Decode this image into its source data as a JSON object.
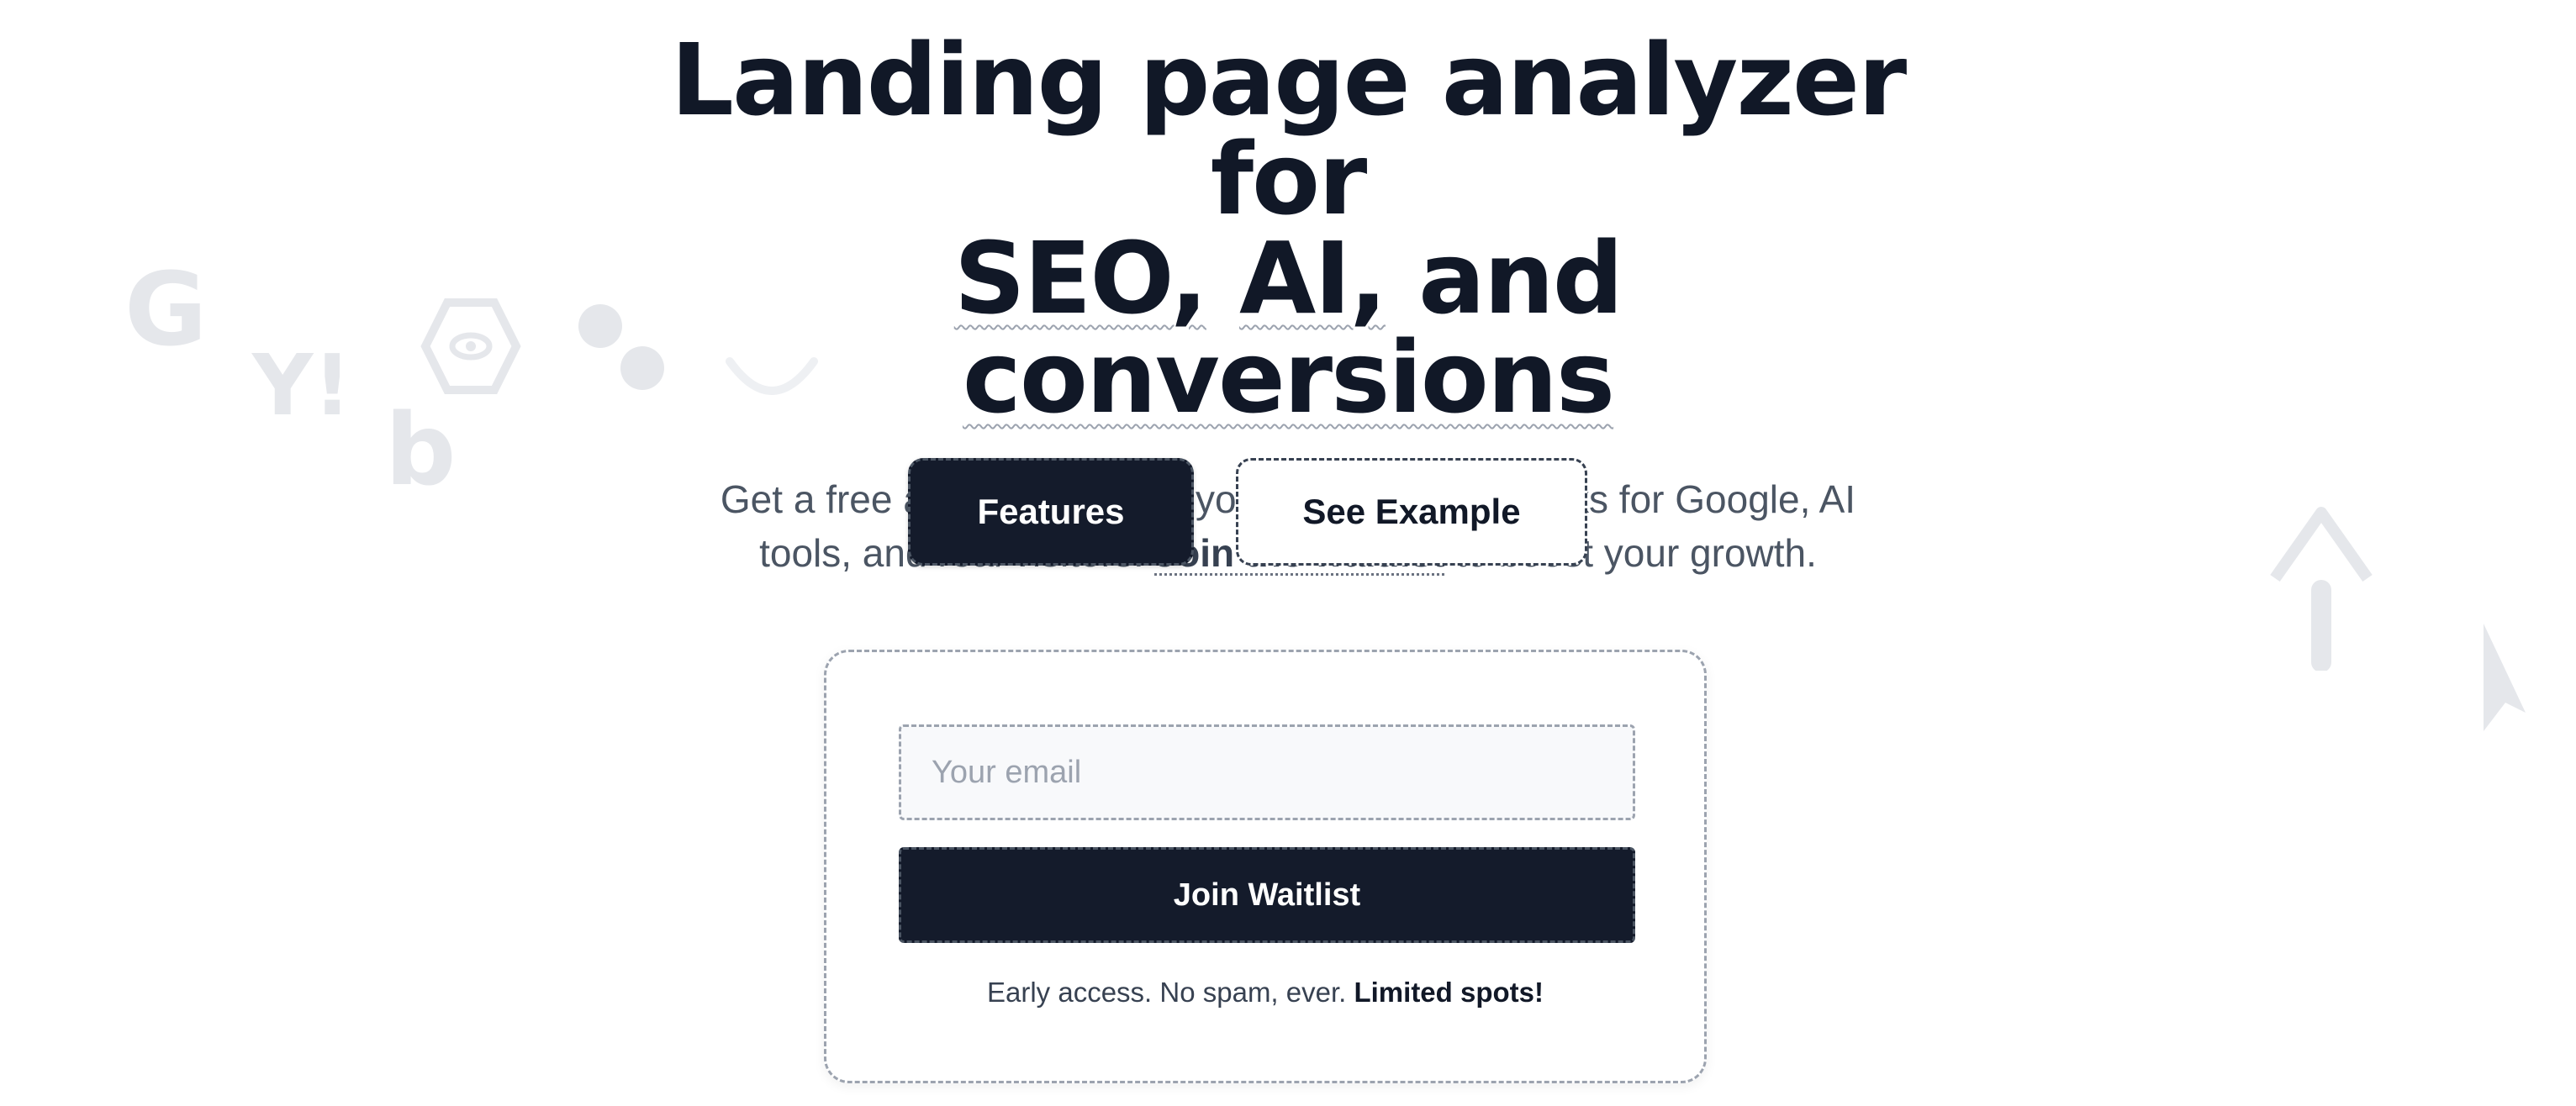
{
  "hero": {
    "title_line1": "Landing page analyzer for",
    "title_seo": "SEO,",
    "title_ai": "AI,",
    "title_and": "and",
    "title_conversions": "conversions",
    "subtitle_before": "Get a free audit to see how your landing page ranks for Google, AI tools, and real visitors.",
    "subtitle_link": "Join the waitlist",
    "subtitle_after": "to boost your growth."
  },
  "cta": {
    "features_label": "Features",
    "see_example_label": "See Example"
  },
  "waitlist": {
    "email_placeholder": "Your email",
    "email_value": "",
    "join_label": "Join Waitlist",
    "note_regular": "Early access. No spam, ever.",
    "note_bold": "Limited spots!"
  },
  "decorations": {
    "google_letter": "G",
    "yahoo_letters": "Y!",
    "bing_letter": "b",
    "icons": [
      "google-icon",
      "yahoo-icon",
      "bing-icon",
      "hexagon-eye-icon",
      "openai-dots-icon",
      "smile-icon",
      "arrow-up-icon",
      "cursor-icon"
    ]
  },
  "colors": {
    "primary_dark": "#141b2b",
    "text_dark": "#111827",
    "text_muted": "#4b5563",
    "decoration": "#e5e7eb",
    "dashed_border": "#9ca3af"
  }
}
